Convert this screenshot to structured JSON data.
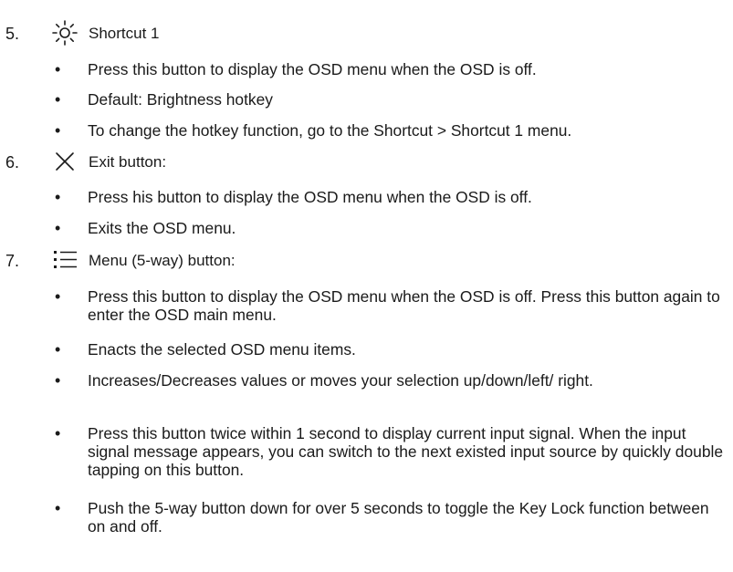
{
  "sections": [
    {
      "number": "5.",
      "icon": "brightness-icon",
      "title": "Shortcut 1",
      "bullets": [
        "Press this button to display the OSD menu when the OSD is off.",
        "Default: Brightness hotkey",
        "To change the hotkey function, go to the Shortcut > Shortcut 1 menu."
      ]
    },
    {
      "number": "6.",
      "icon": "close-icon",
      "title": "Exit button:",
      "bullets": [
        "Press his button to display the OSD menu when the OSD is off.",
        "Exits the OSD menu."
      ]
    },
    {
      "number": "7.",
      "icon": "menu-list-icon",
      "title": "Menu (5-way) button:",
      "bullets": [
        "Press this button to display the OSD menu when the OSD is off. Press this button again to enter the OSD main menu.",
        "Enacts the selected OSD menu items.",
        "Increases/Decreases values or moves your selection up/down/left/ right.",
        "Press this button twice within 1 second to display current input signal. When the input signal message appears, you can switch to the next existed input source by quickly double tapping on this button.",
        "Push the 5-way button down for over 5 seconds to toggle the Key Lock function between on and off."
      ]
    }
  ]
}
